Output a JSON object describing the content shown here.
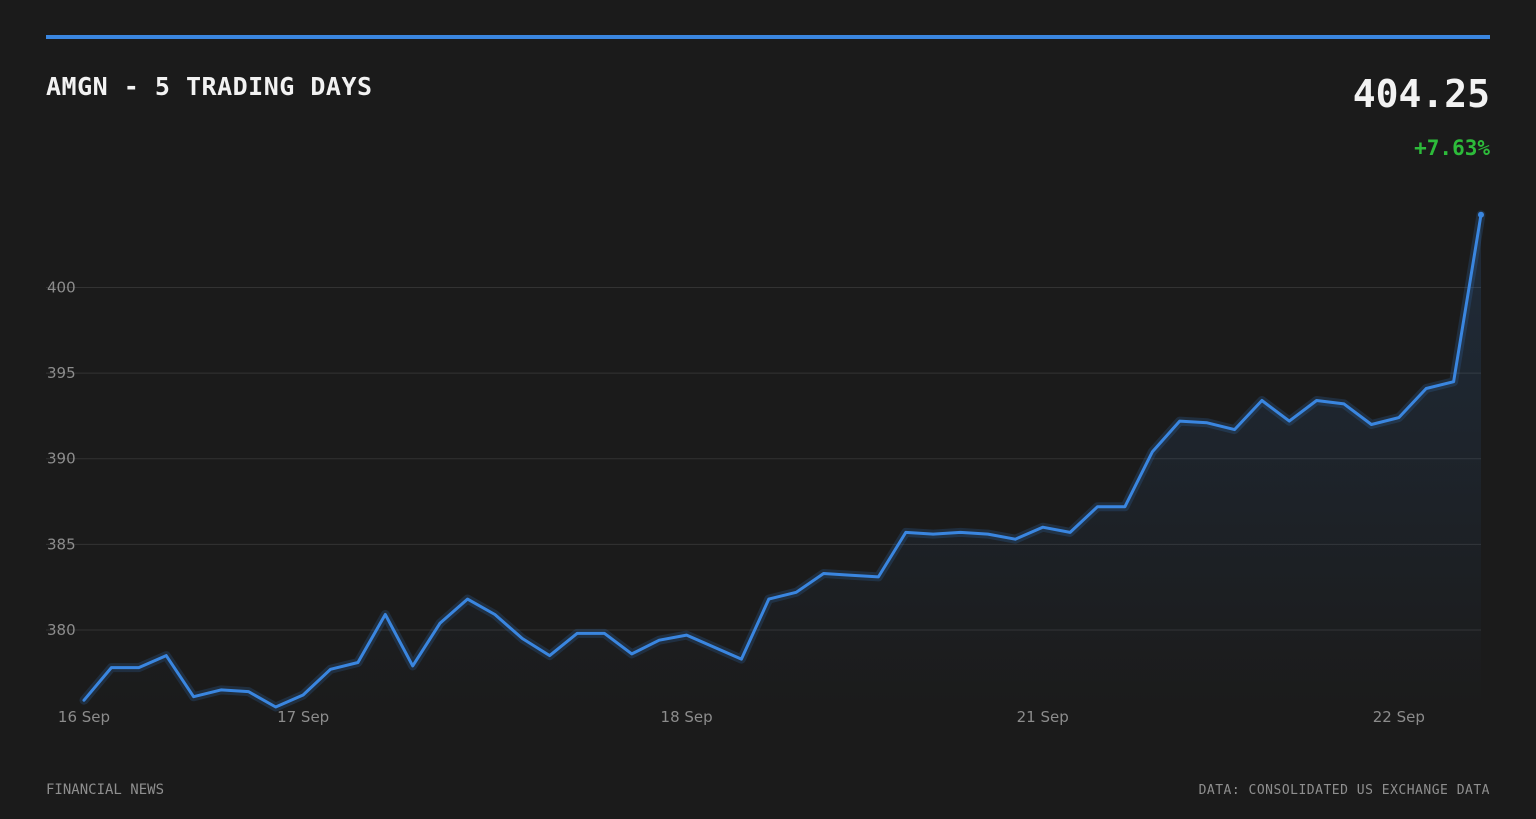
{
  "header": {
    "title": "AMGN - 5 TRADING DAYS",
    "price": "404.25",
    "change": "+7.63%"
  },
  "footer": {
    "left": "FINANCIAL NEWS",
    "right": "DATA: CONSOLIDATED US EXCHANGE DATA"
  },
  "colors": {
    "background": "#1b1b1b",
    "accent": "#3a86e0",
    "positive": "#2dbb3a",
    "grid": "#333333"
  },
  "chart_data": {
    "type": "area",
    "ylim": [
      375.5,
      409.2
    ],
    "yticks": [
      380,
      385,
      390,
      395,
      400
    ],
    "xticks": [
      {
        "label": "16 Sep",
        "index": 0
      },
      {
        "label": "17 Sep",
        "index": 8
      },
      {
        "label": "18 Sep",
        "index": 22
      },
      {
        "label": "21 Sep",
        "index": 35
      },
      {
        "label": "22 Sep",
        "index": 48
      }
    ],
    "grid": true,
    "series": [
      {
        "values": [
          375.9,
          377.8,
          377.8,
          378.5,
          376.1,
          376.5,
          376.4,
          375.5,
          376.2,
          377.7,
          378.1,
          380.9,
          377.9,
          380.4,
          381.8,
          380.9,
          379.5,
          378.5,
          379.8,
          379.8,
          378.6,
          379.4,
          379.7,
          379.0,
          378.3,
          381.8,
          382.2,
          383.3,
          383.2,
          383.1,
          385.7,
          385.6,
          385.7,
          385.6,
          385.3,
          386.0,
          385.7,
          387.2,
          387.2,
          390.4,
          392.2,
          392.1,
          391.7,
          393.4,
          392.2,
          393.4,
          393.2,
          392.0,
          392.4,
          394.1,
          394.5,
          404.25
        ]
      }
    ]
  }
}
